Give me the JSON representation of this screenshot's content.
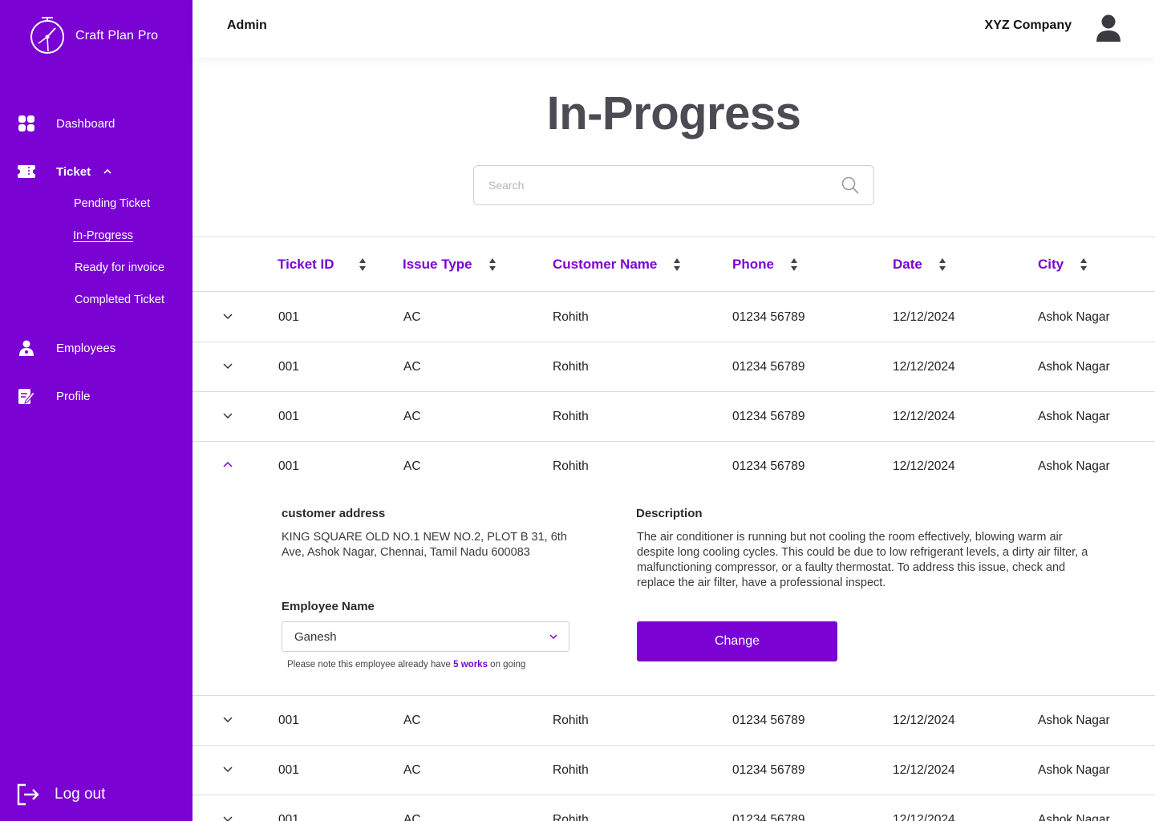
{
  "brand": {
    "name": "Craft Plan Pro"
  },
  "header": {
    "role": "Admin",
    "company": "XYZ Company"
  },
  "sidebar": {
    "items": [
      {
        "label": "Dashboard",
        "icon": "grid-icon"
      },
      {
        "label": "Ticket",
        "icon": "ticket-icon"
      },
      {
        "label": "Employees",
        "icon": "employee-icon"
      },
      {
        "label": "Profile",
        "icon": "profile-edit-icon"
      }
    ],
    "ticket_sub": [
      {
        "label": "Pending Ticket"
      },
      {
        "label": "In-Progress",
        "active": true
      },
      {
        "label": "Ready for invoice"
      },
      {
        "label": "Completed Ticket"
      }
    ],
    "logout": "Log out"
  },
  "page": {
    "title": "In-Progress",
    "search_placeholder": "Search"
  },
  "table": {
    "columns": [
      "Ticket ID",
      "Issue Type",
      "Customer Name",
      "Phone",
      "Date",
      "City"
    ],
    "rows": [
      {
        "id": "001",
        "issue": "AC",
        "customer": "Rohith",
        "phone": "01234 56789",
        "date": "12/12/2024",
        "city": "Ashok Nagar"
      },
      {
        "id": "001",
        "issue": "AC",
        "customer": "Rohith",
        "phone": "01234 56789",
        "date": "12/12/2024",
        "city": "Ashok Nagar"
      },
      {
        "id": "001",
        "issue": "AC",
        "customer": "Rohith",
        "phone": "01234 56789",
        "date": "12/12/2024",
        "city": "Ashok Nagar"
      },
      {
        "id": "001",
        "issue": "AC",
        "customer": "Rohith",
        "phone": "01234 56789",
        "date": "12/12/2024",
        "city": "Ashok Nagar",
        "expanded": true
      },
      {
        "id": "001",
        "issue": "AC",
        "customer": "Rohith",
        "phone": "01234 56789",
        "date": "12/12/2024",
        "city": "Ashok Nagar"
      },
      {
        "id": "001",
        "issue": "AC",
        "customer": "Rohith",
        "phone": "01234 56789",
        "date": "12/12/2024",
        "city": "Ashok Nagar"
      },
      {
        "id": "001",
        "issue": "AC",
        "customer": "Rohith",
        "phone": "01234 56789",
        "date": "12/12/2024",
        "city": "Ashok Nagar"
      }
    ]
  },
  "detail": {
    "address_label": "customer address",
    "address": "KING SQUARE OLD NO.1 NEW NO.2, PLOT B 31, 6th Ave, Ashok Nagar, Chennai, Tamil Nadu 600083",
    "description_label": "Description",
    "description": "The air conditioner is running but not cooling the room effectively, blowing warm air despite long cooling cycles. This could be due to low refrigerant levels, a dirty air filter, a malfunctioning compressor, or a faulty thermostat. To address this issue, check and replace the air filter, have a professional inspect.",
    "employee_label": "Employee Name",
    "employee_selected": "Ganesh",
    "note_prefix": "Please note this employee already have",
    "note_highlight": "5 works",
    "note_suffix": "on going",
    "change_button": "Change"
  },
  "colors": {
    "accent": "#7a02d3",
    "title": "#4c4b53"
  }
}
